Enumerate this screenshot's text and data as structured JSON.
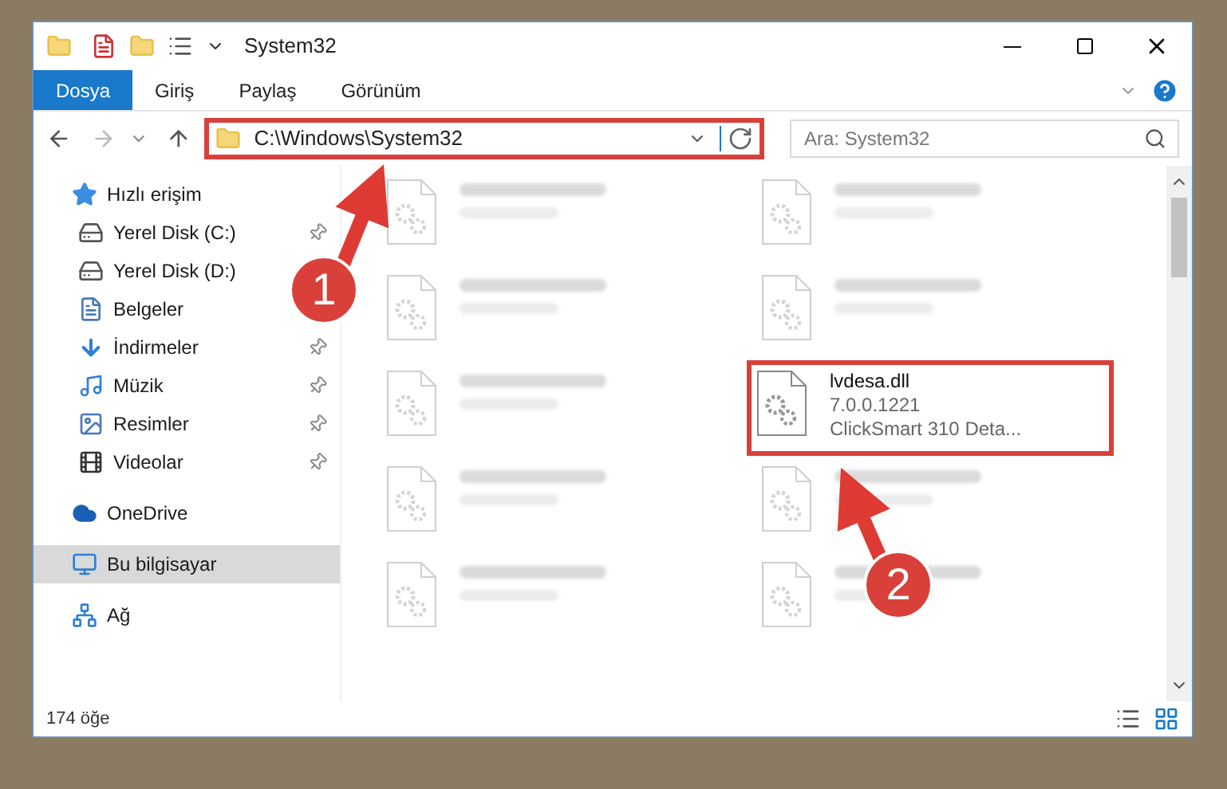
{
  "window": {
    "title": "System32"
  },
  "ribbon_tabs": [
    {
      "label": "Dosya",
      "selected": true
    },
    {
      "label": "Giriş",
      "selected": false
    },
    {
      "label": "Paylaş",
      "selected": false
    },
    {
      "label": "Görünüm",
      "selected": false
    }
  ],
  "address_bar": {
    "value": "C:\\Windows\\System32",
    "highlighted": true
  },
  "search": {
    "placeholder": "Ara: System32"
  },
  "sidebar": {
    "items": [
      {
        "label": "Hızlı erişim",
        "kind": "star",
        "pinned": false,
        "selected": false,
        "children": [
          {
            "label": "Yerel Disk (C:)",
            "kind": "drive",
            "pinned": true,
            "selected": false
          },
          {
            "label": "Yerel Disk (D:)",
            "kind": "drive",
            "pinned": false,
            "selected": false
          },
          {
            "label": "Belgeler",
            "kind": "document",
            "pinned": false,
            "selected": false
          },
          {
            "label": "İndirmeler",
            "kind": "download",
            "pinned": true,
            "selected": false
          },
          {
            "label": "Müzik",
            "kind": "music",
            "pinned": true,
            "selected": false
          },
          {
            "label": "Resimler",
            "kind": "picture",
            "pinned": true,
            "selected": false
          },
          {
            "label": "Videolar",
            "kind": "video",
            "pinned": true,
            "selected": false
          }
        ]
      },
      {
        "label": "OneDrive",
        "kind": "cloud",
        "pinned": false,
        "selected": false
      },
      {
        "label": "Bu bilgisayar",
        "kind": "computer",
        "pinned": false,
        "selected": true
      },
      {
        "label": "Ağ",
        "kind": "network",
        "pinned": false,
        "selected": false
      }
    ]
  },
  "files": [
    {
      "kind": "blurred",
      "highlighted": false
    },
    {
      "kind": "blurred",
      "highlighted": false
    },
    {
      "kind": "blurred",
      "highlighted": false
    },
    {
      "kind": "blurred",
      "highlighted": false
    },
    {
      "kind": "blurred",
      "highlighted": false
    },
    {
      "kind": "file",
      "name": "lvdesa.dll",
      "lines": [
        "7.0.0.1221",
        "ClickSmart 310 Deta..."
      ],
      "highlighted": true
    },
    {
      "kind": "blurred",
      "highlighted": false
    },
    {
      "kind": "blurred",
      "highlighted": false
    },
    {
      "kind": "blurred",
      "highlighted": false
    },
    {
      "kind": "blurred",
      "highlighted": false
    }
  ],
  "status_bar": {
    "count": "174 öğe"
  },
  "annotations": [
    {
      "number": "1"
    },
    {
      "number": "2"
    }
  ]
}
